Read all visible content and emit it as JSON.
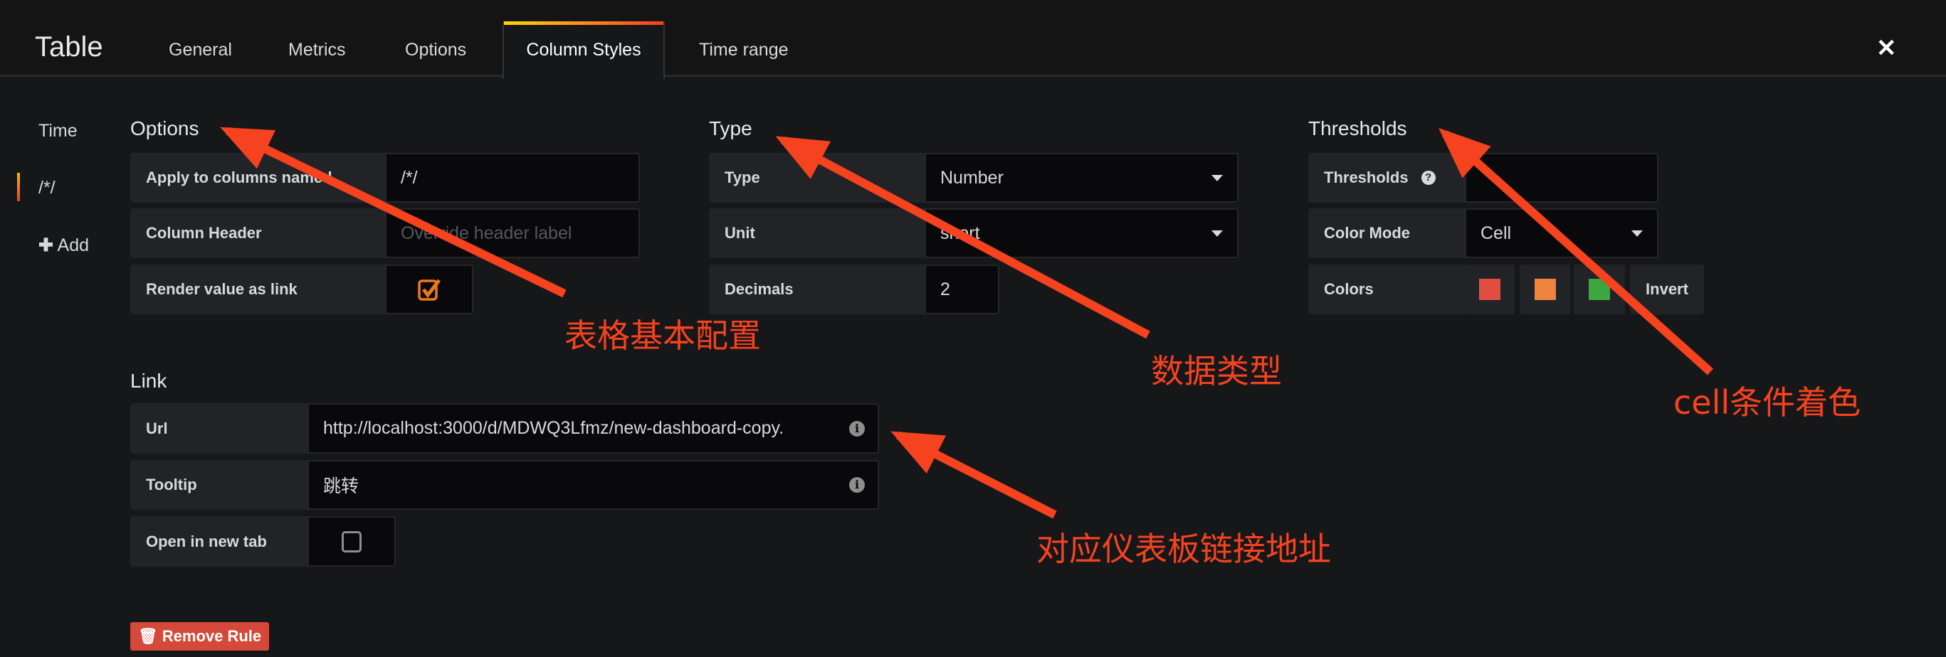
{
  "header": {
    "title": "Table",
    "tabs": [
      {
        "label": "General"
      },
      {
        "label": "Metrics"
      },
      {
        "label": "Options"
      },
      {
        "label": "Column Styles",
        "active": true
      },
      {
        "label": "Time range"
      }
    ],
    "close_icon": "close-icon"
  },
  "sidebar": {
    "items": [
      {
        "label": "Time"
      },
      {
        "label": "/*/",
        "active": true
      },
      {
        "label": "Add"
      }
    ]
  },
  "options": {
    "heading": "Options",
    "apply_label": "Apply to columns named",
    "apply_value": "/*/",
    "header_label": "Column Header",
    "header_placeholder": "Override header label",
    "link_label": "Render value as link",
    "link_checked": true
  },
  "type": {
    "heading": "Type",
    "type_label": "Type",
    "type_value": "Number",
    "unit_label": "Unit",
    "unit_value": "short",
    "decimals_label": "Decimals",
    "decimals_value": "2"
  },
  "thresholds": {
    "heading": "Thresholds",
    "thresholds_label": "Thresholds",
    "thresholds_value": "",
    "color_mode_label": "Color Mode",
    "color_mode_value": "Cell",
    "colors_label": "Colors",
    "colors": [
      "#e24d42",
      "#ef843c",
      "#3ca63f"
    ],
    "invert_label": "Invert"
  },
  "link": {
    "heading": "Link",
    "url_label": "Url",
    "url_value": "http://localhost:3000/d/MDWQ3Lfmz/new-dashboard-copy.",
    "tooltip_label": "Tooltip",
    "tooltip_value": "跳转",
    "new_tab_label": "Open in new tab",
    "new_tab_checked": false
  },
  "remove_rule": "Remove Rule",
  "annotations": {
    "options": "表格基本配置",
    "type": "数据类型",
    "thresholds": "cell条件着色",
    "link": "对应仪表板链接地址",
    "color": "#f5421f"
  }
}
